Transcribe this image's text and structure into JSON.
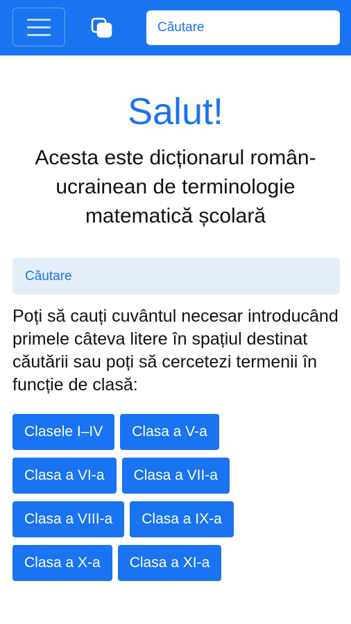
{
  "header": {
    "menu_icon": "hamburger-icon",
    "copy_icon": "copy-icon",
    "search_placeholder": "Căutare",
    "colors": {
      "bar": "#1a73f0"
    }
  },
  "main": {
    "title": "Salut!",
    "subtitle": "Acesta este dicționarul român-ucrainean de terminologie matematică școlară",
    "search_placeholder": "Căutare",
    "intro": "Poți să cauți cuvântul necesar introducând primele câteva litere în spațiul destinat căutării sau poți să cercetezi termenii în funcție de clasă:",
    "grade_rows": [
      [
        "Clasele I–IV",
        "Clasa a V-a"
      ],
      [
        "Clasa a VI-a",
        "Clasa a VII-a"
      ],
      [
        "Clasa a VIII-a",
        "Clasa a IX-a"
      ],
      [
        "Clasa a X-a",
        "Clasa a XI-a"
      ]
    ]
  }
}
